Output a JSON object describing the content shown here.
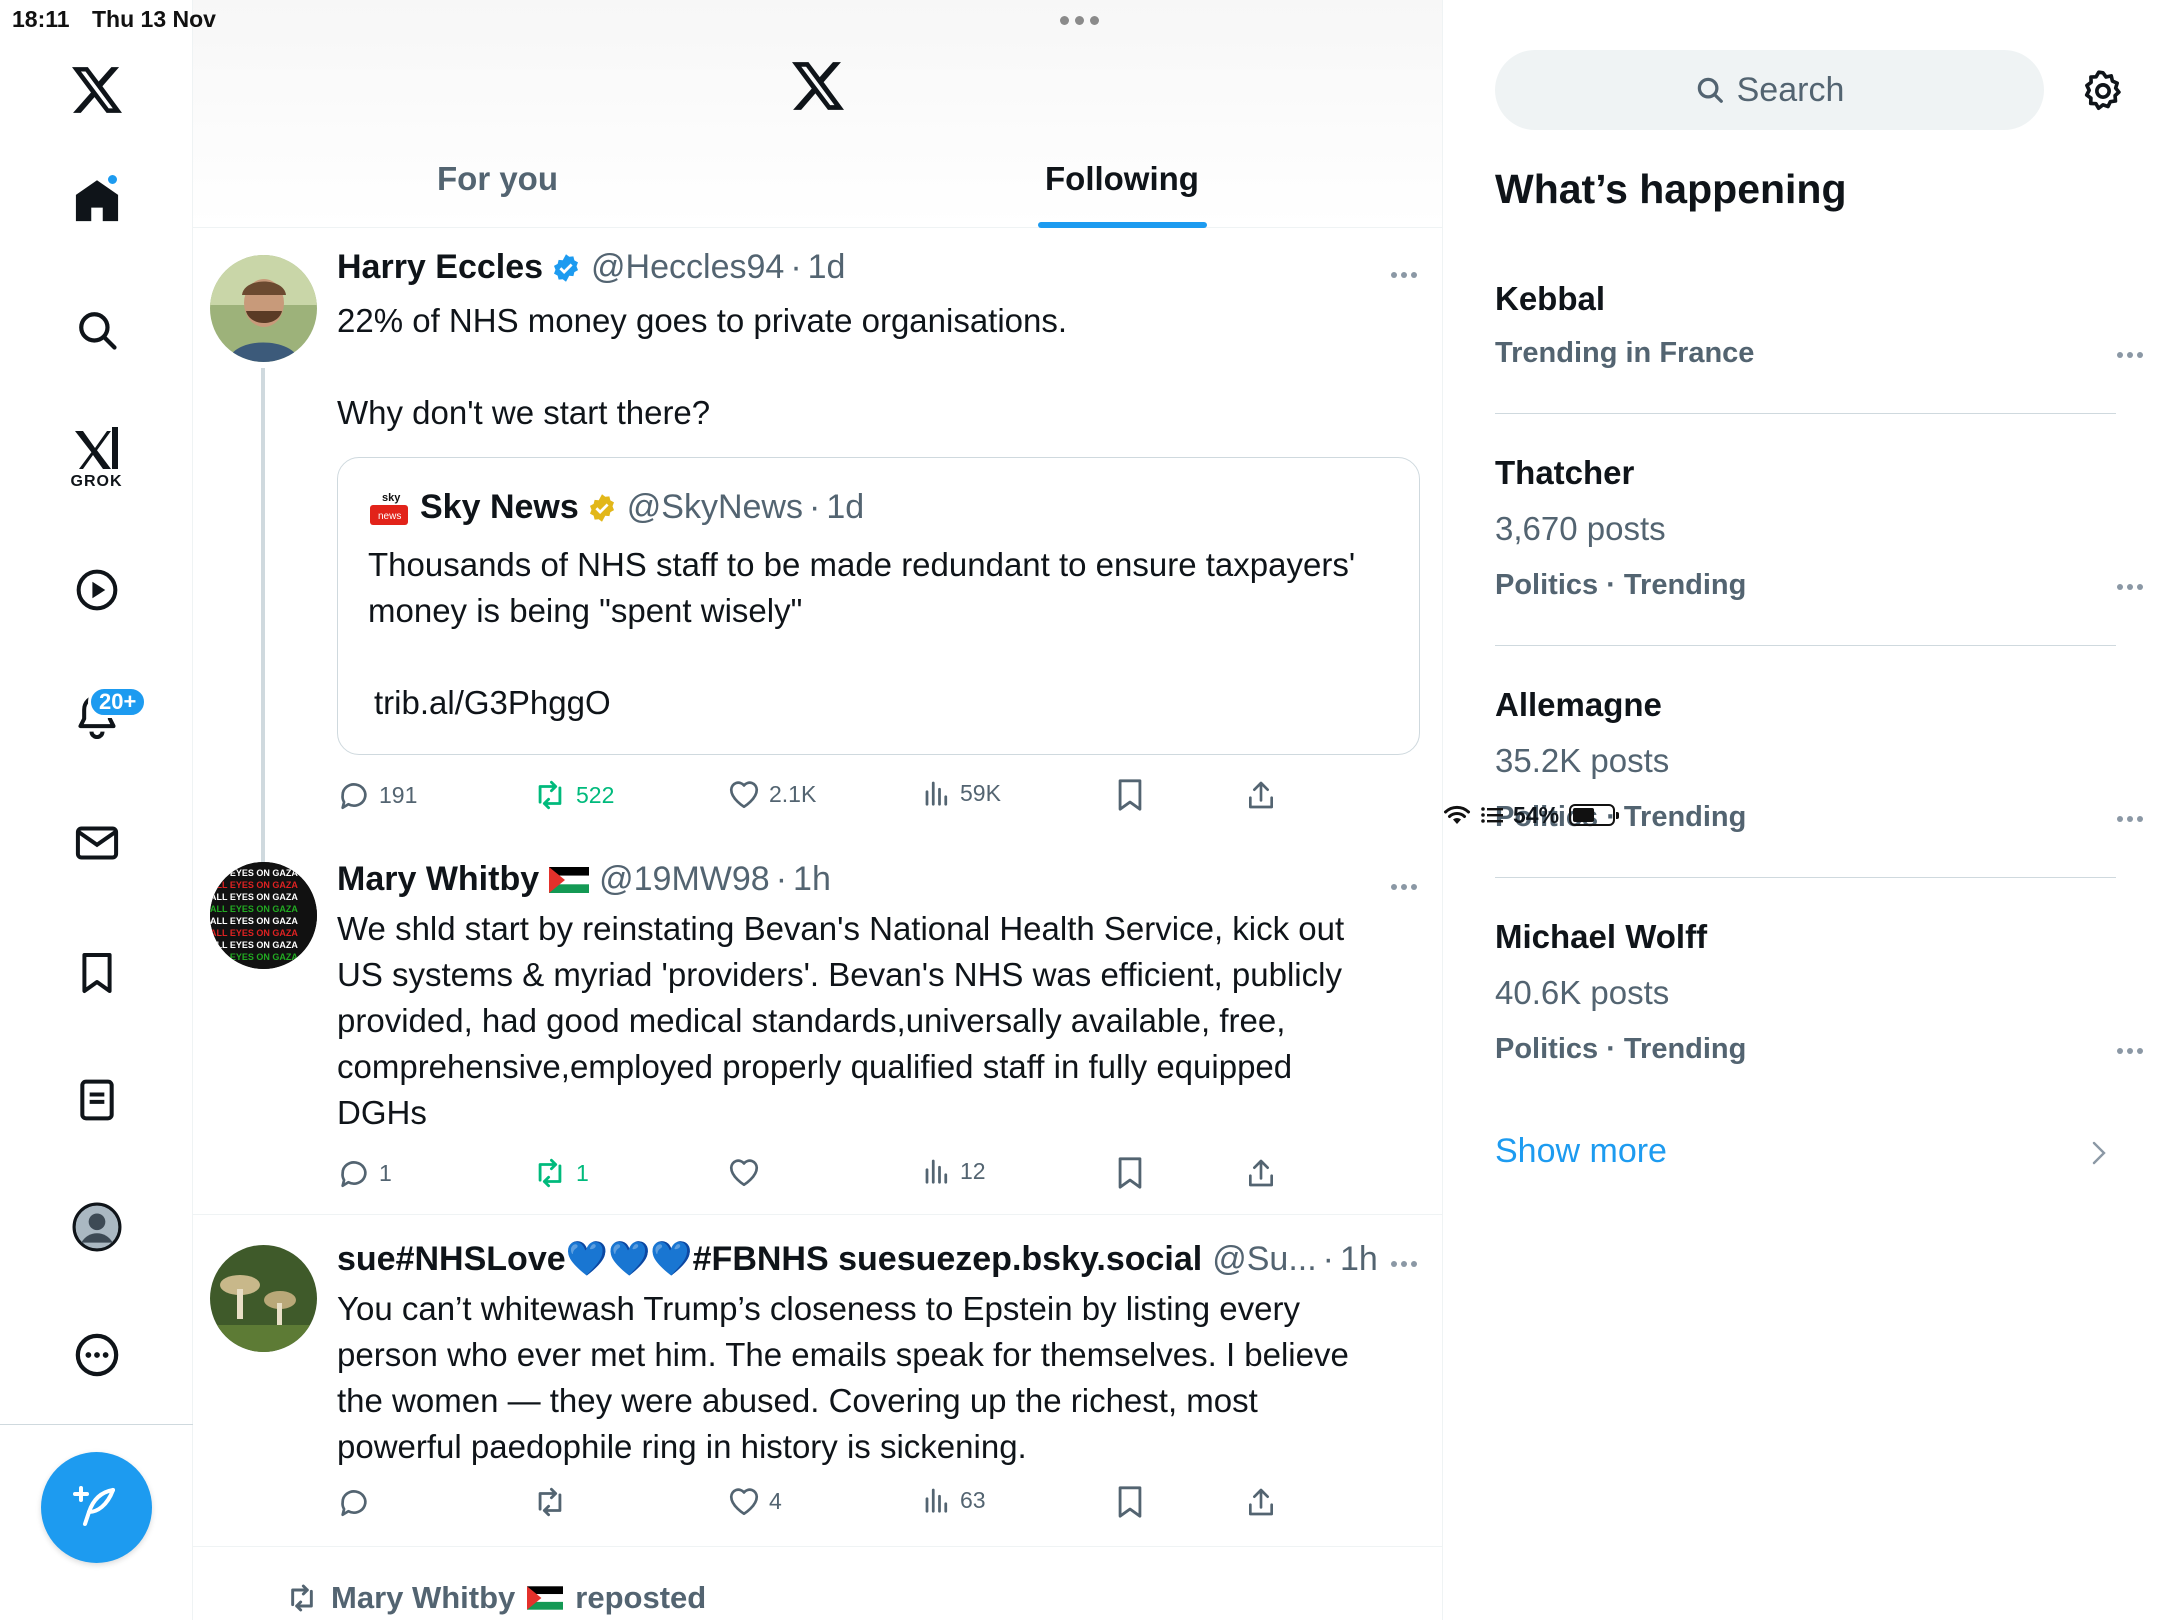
{
  "status_bar": {
    "time": "18:11",
    "date": "Thu 13 Nov",
    "battery": "54%",
    "battery_level": 0.54
  },
  "nav": {
    "grok_label": "GROK",
    "notifications_badge": "20+"
  },
  "header": {
    "tabs": [
      {
        "label": "For you",
        "active": false
      },
      {
        "label": "Following",
        "active": true
      }
    ]
  },
  "posts": [
    {
      "name": "Harry Eccles",
      "handle": "@Heccles94",
      "time": "1d",
      "text": "22% of NHS money goes to private organisations.\n\nWhy don't we start there?",
      "quote": {
        "source_logo_text": "sky news",
        "name": "Sky News",
        "handle": "@SkyNews",
        "time": "1d",
        "text": "Thousands of NHS staff to be made redundant to ensure taxpayers' money is being \"spent wisely\"",
        "link": "trib.al/G3PhggO"
      },
      "stats": {
        "replies": "191",
        "reposts": "522",
        "likes": "2.1K",
        "views": "59K"
      }
    },
    {
      "name": "Mary Whitby",
      "handle": "@19MW98",
      "time": "1h",
      "text": "We shld start by reinstating Bevan's National Health Service, kick out US systems & myriad 'providers'. Bevan's NHS was efficient, publicly provided, had good medical standards,universally available, free, comprehensive,employed properly qualified staff in fully equipped DGHs",
      "avatar_text": "ALL EYES ON GAZA CITY",
      "stats": {
        "replies": "1",
        "reposts": "1",
        "likes": "",
        "views": "12"
      }
    },
    {
      "name": "sue#NHSLove💙💙💙#FBNHS suesuezep.bsky.social",
      "handle": "@Su...",
      "time": "1h",
      "text": "You can’t whitewash Trump’s closeness to Epstein by listing every person who ever met him. The emails speak for themselves. I believe the women — they were abused. Covering up the richest, most powerful paedophile ring in history is sickening.",
      "stats": {
        "replies": "",
        "reposts": "",
        "likes": "4",
        "views": "63"
      }
    }
  ],
  "repost_notice": {
    "name": "Mary Whitby",
    "label": "reposted"
  },
  "sidebar": {
    "search_placeholder": "Search",
    "title": "What’s happening",
    "trends": [
      {
        "name": "Kebbal",
        "posts": "",
        "meta": "Trending in France"
      },
      {
        "name": "Thatcher",
        "posts": "3,670 posts",
        "meta": "Politics · Trending"
      },
      {
        "name": "Allemagne",
        "posts": "35.2K posts",
        "meta": "Politics · Trending"
      },
      {
        "name": "Michael Wolff",
        "posts": "40.6K posts",
        "meta": "Politics · Trending"
      }
    ],
    "show_more": "Show more"
  },
  "colors": {
    "accent": "#1d9bf0",
    "repost_green": "#00ba7c",
    "secondary_text": "#536471",
    "verified_gold": "#e2b719"
  }
}
